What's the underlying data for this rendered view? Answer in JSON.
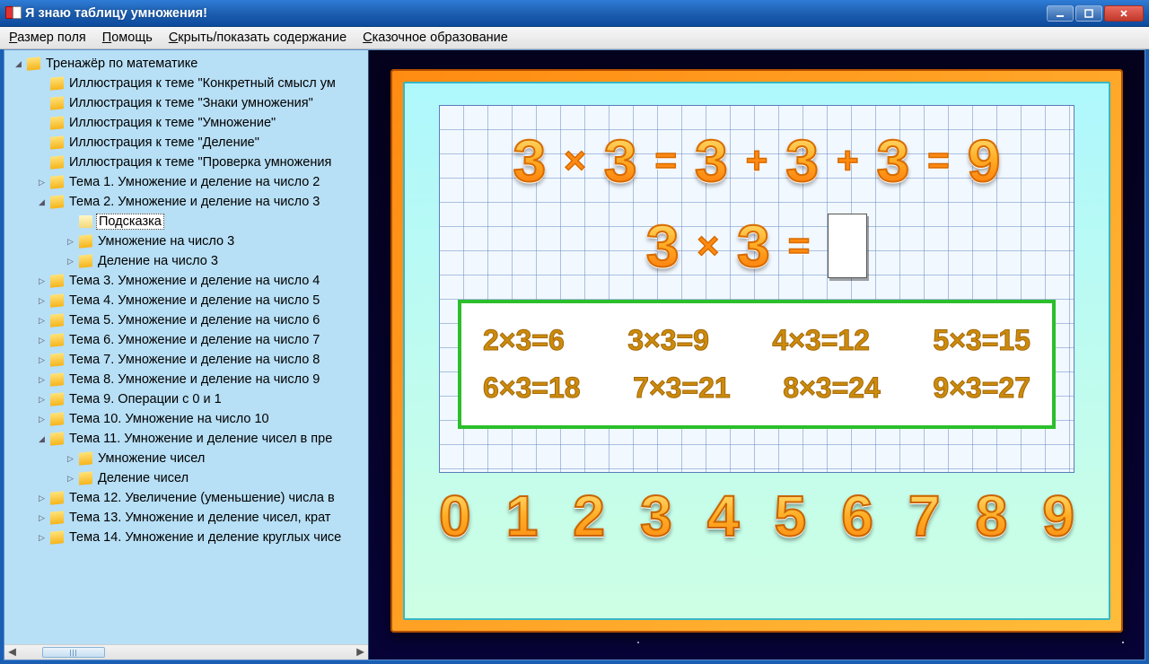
{
  "window": {
    "title": "Я знаю таблицу умножения!"
  },
  "menu": {
    "items": [
      {
        "label": "Размер поля",
        "ul": "Р",
        "rest": "азмер поля"
      },
      {
        "label": "Помощь",
        "ul": "П",
        "rest": "омощь"
      },
      {
        "label": "Скрыть/показать содержание",
        "ul": "С",
        "rest": "крыть/показать содержание"
      },
      {
        "label": "Сказочное образование",
        "ul": "С",
        "rest": "казочное образование"
      }
    ]
  },
  "tree": [
    {
      "level": 1,
      "twisty": "down",
      "icon": "topic",
      "label": "Тренажёр по математике",
      "selected": false
    },
    {
      "level": 2,
      "twisty": "blank",
      "icon": "topic",
      "label": "Иллюстрация к теме \"Конкретный смысл ум",
      "selected": false
    },
    {
      "level": 2,
      "twisty": "blank",
      "icon": "topic",
      "label": "Иллюстрация к теме \"Знаки умножения\"",
      "selected": false
    },
    {
      "level": 2,
      "twisty": "blank",
      "icon": "topic",
      "label": "Иллюстрация к теме \"Умножение\"",
      "selected": false
    },
    {
      "level": 2,
      "twisty": "blank",
      "icon": "topic",
      "label": "Иллюстрация к теме \"Деление\"",
      "selected": false
    },
    {
      "level": 2,
      "twisty": "blank",
      "icon": "topic",
      "label": "Иллюстрация к теме \"Проверка умножения",
      "selected": false
    },
    {
      "level": 2,
      "twisty": "right",
      "icon": "topic",
      "label": "Тема 1. Умножение и деление на число 2",
      "selected": false
    },
    {
      "level": 2,
      "twisty": "down",
      "icon": "topic",
      "label": "Тема 2. Умножение и деление на число 3",
      "selected": false
    },
    {
      "level": 3,
      "twisty": "blank",
      "icon": "open",
      "label": "Подсказка",
      "selected": true
    },
    {
      "level": 3,
      "twisty": "right",
      "icon": "topic",
      "label": "Умножение на число 3",
      "selected": false
    },
    {
      "level": 3,
      "twisty": "right",
      "icon": "topic",
      "label": "Деление на число 3",
      "selected": false
    },
    {
      "level": 2,
      "twisty": "right",
      "icon": "topic",
      "label": "Тема 3. Умножение и деление на число 4",
      "selected": false
    },
    {
      "level": 2,
      "twisty": "right",
      "icon": "topic",
      "label": "Тема 4. Умножение и деление на число 5",
      "selected": false
    },
    {
      "level": 2,
      "twisty": "right",
      "icon": "topic",
      "label": "Тема 5. Умножение и деление на число 6",
      "selected": false
    },
    {
      "level": 2,
      "twisty": "right",
      "icon": "topic",
      "label": "Тема 6. Умножение и деление на число 7",
      "selected": false
    },
    {
      "level": 2,
      "twisty": "right",
      "icon": "topic",
      "label": "Тема 7. Умножение и деление на число 8",
      "selected": false
    },
    {
      "level": 2,
      "twisty": "right",
      "icon": "topic",
      "label": "Тема 8. Умножение и деление на число 9",
      "selected": false
    },
    {
      "level": 2,
      "twisty": "right",
      "icon": "topic",
      "label": "Тема 9. Операции с 0 и 1",
      "selected": false
    },
    {
      "level": 2,
      "twisty": "right",
      "icon": "topic",
      "label": "Тема 10. Умножение на число 10",
      "selected": false
    },
    {
      "level": 2,
      "twisty": "down",
      "icon": "topic",
      "label": "Тема 11. Умножение и деление чисел в пре",
      "selected": false
    },
    {
      "level": 3,
      "twisty": "right",
      "icon": "topic",
      "label": "Умножение чисел",
      "selected": false
    },
    {
      "level": 3,
      "twisty": "right",
      "icon": "topic",
      "label": "Деление чисел",
      "selected": false
    },
    {
      "level": 2,
      "twisty": "right",
      "icon": "topic",
      "label": "Тема 12. Увеличение (уменьшение) числа в",
      "selected": false
    },
    {
      "level": 2,
      "twisty": "right",
      "icon": "topic",
      "label": "Тема 13. Умножение и деление чисел, крат",
      "selected": false
    },
    {
      "level": 2,
      "twisty": "right",
      "icon": "topic",
      "label": "Тема 14. Умножение и деление круглых чисе",
      "selected": false
    }
  ],
  "lesson": {
    "top_tokens": [
      "3",
      "×",
      "3",
      "=",
      "3",
      "+",
      "3",
      "+",
      "3",
      "=",
      "9"
    ],
    "mid_tokens": [
      "3",
      "×",
      "3",
      "="
    ],
    "facts_row1": [
      "2×3=6",
      "3×3=9",
      "4×3=12",
      "5×3=15"
    ],
    "facts_row2": [
      "6×3=18",
      "7×3=21",
      "8×3=24",
      "9×3=27"
    ],
    "digits": [
      "0",
      "1",
      "2",
      "3",
      "4",
      "5",
      "6",
      "7",
      "8",
      "9"
    ]
  },
  "scrollbar": {
    "thumb_label": "|||"
  }
}
